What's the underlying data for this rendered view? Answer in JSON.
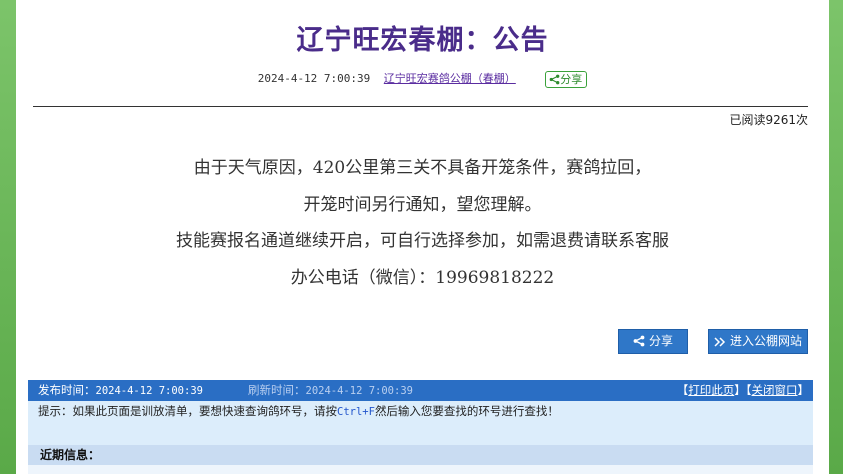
{
  "notice": {
    "title": "辽宁旺宏春棚：公告",
    "date": "2024-4-12 7:00:39",
    "club_link": "辽宁旺宏赛鸽公棚（春棚）",
    "share_badge": "分享",
    "read_count": "已阅读9261次"
  },
  "content": {
    "lines": [
      "由于天气原因，420公里第三关不具备开笼条件，赛鸽拉回，",
      "开笼时间另行通知，望您理解。",
      "技能赛报名通道继续开启，可自行选择参加，如需退费请联系客服",
      "办公电话（微信）：19969818222"
    ]
  },
  "buttons": {
    "share": "分享",
    "enter_site": "进入公棚网站"
  },
  "info_bar": {
    "publish_label": "发布时间：",
    "publish_time": "2024-4-12 7:00:39",
    "refresh_label": "刷新时间：",
    "refresh_time": "2024-4-12 7:00:39",
    "print_link": "打印此页",
    "close_link": "关闭窗口"
  },
  "tip": {
    "prefix": "提示：如果此页面是训放清单，要想快速查询鸽环号，请按",
    "key": "Ctrl+F",
    "suffix": "然后输入您要查找的环号进行查找！"
  },
  "recent": {
    "label": "近期信息："
  },
  "colors": {
    "title": "#4a2c8a",
    "accent_blue": "#2a6ec4",
    "side_green": "#6bb85a"
  }
}
